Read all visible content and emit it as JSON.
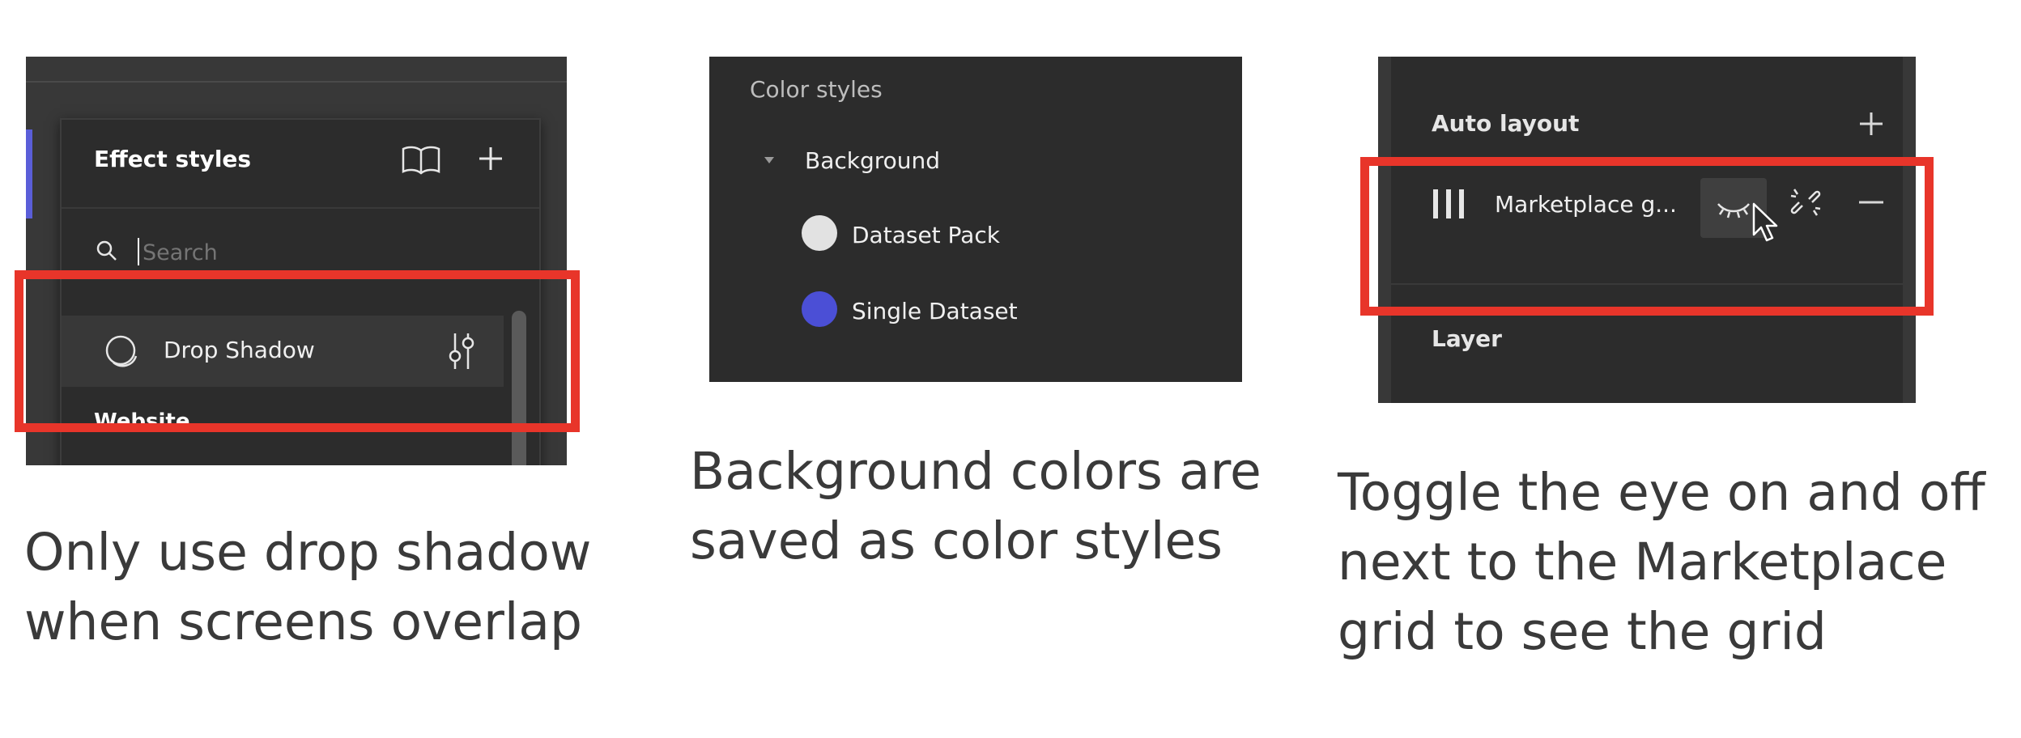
{
  "panel1": {
    "title": "Effect styles",
    "search_placeholder": "Search",
    "effect_item_label": "Drop Shadow",
    "group_label": "Website",
    "icons": [
      "library-icon",
      "plus-icon",
      "search-icon",
      "drop-shadow-icon",
      "adjust-icon"
    ]
  },
  "panel2": {
    "title": "Color styles",
    "group_label": "Background",
    "styles": [
      {
        "label": "Dataset Pack",
        "color": "#e2e2e2"
      },
      {
        "label": "Single Dataset",
        "color": "#4b4fd6"
      }
    ]
  },
  "panel3": {
    "section_title": "Auto layout",
    "grid_label": "Marketplace g...",
    "layer_title": "Layer",
    "icons": [
      "plus-icon",
      "grid-columns-icon",
      "eye-closed-icon",
      "cursor-icon",
      "detach-icon",
      "minus-icon"
    ]
  },
  "captions": {
    "caption1": "Only use drop shadow\nwhen screens overlap",
    "caption2": "Background colors are\nsaved as color styles",
    "caption3": "Toggle the eye on and off\nnext to the Marketplace\ngrid to see the grid"
  },
  "colors": {
    "highlight_border": "#e8352a",
    "panel_bg": "#2c2c2c"
  }
}
